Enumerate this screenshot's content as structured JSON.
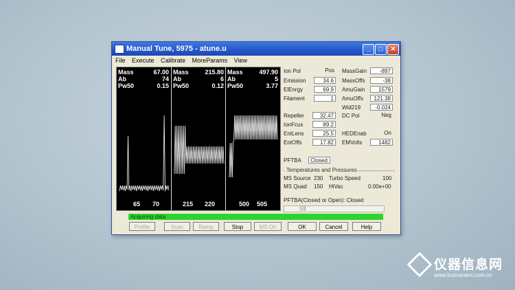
{
  "window": {
    "title": "Manual Tune, 5975 - atune.u",
    "controls": {
      "minimize": "_",
      "maximize": "□",
      "close": "✕"
    }
  },
  "menu": [
    "File",
    "Execute",
    "Calibrate",
    "MoreParams",
    "View"
  ],
  "spectra": {
    "panels": [
      {
        "mass_label": "Mass",
        "mass": "67.00",
        "ab_label": "Ab",
        "ab": "74",
        "pw_label": "Pw50",
        "pw": "0.15",
        "ticks": [
          "65",
          "70"
        ]
      },
      {
        "mass_label": "Mass",
        "mass": "215.80",
        "ab_label": "Ab",
        "ab": "6",
        "pw_label": "Pw50",
        "pw": "0.12",
        "ticks": [
          "215",
          "220"
        ]
      },
      {
        "mass_label": "Mass",
        "mass": "497.90",
        "ab_label": "Ab",
        "ab": "5",
        "pw_label": "Pw50",
        "pw": "3.77",
        "ticks": [
          "500",
          "505"
        ]
      }
    ]
  },
  "params": {
    "ion_pol_label": "Ion Pol",
    "ion_pol": "Pos",
    "emission_label": "Emission",
    "emission": "34.6",
    "elenrgy_label": "ElEnrgy",
    "elenrgy": "69.9",
    "filament_label": "Filament",
    "filament": "1",
    "repeller_label": "Repeller",
    "repeller": "32.47",
    "ionfcus_label": "IonFcus",
    "ionfcus": "89.2",
    "entlens_label": "EntLens",
    "entlens": "25.5",
    "entoffs_label": "EntOffs",
    "entoffs": "17.82",
    "massgain_label": "MassGain",
    "massgain": "-897",
    "massoffs_label": "MassOffs",
    "massoffs": "-38",
    "amugain_label": "AmuGain",
    "amugain": "1579",
    "amuoffs_label": "AmuOffs",
    "amuoffs": "121.38",
    "wid219_label": "Wid219",
    "wid219": "-0.024",
    "dcpol_label": "DC Pol",
    "dcpol": "Neg",
    "hedenab_label": "HEDEnab",
    "hedenab": "On",
    "emvolts_label": "EMVolts",
    "emvolts": "1482",
    "pftba_label": "PFTBA",
    "pftba": "Closed"
  },
  "temps": {
    "group_title": "Temperatures and Pressures",
    "ms_source_label": "MS Source",
    "ms_source": "230",
    "turbo_label": "Turbo Speed",
    "turbo": "100",
    "ms_quad_label": "MS Quad",
    "ms_quad": "150",
    "hivac_label": "HiVac",
    "hivac": "0.00e+00",
    "pftba_status": "PFTBA(Closed or   Open): Closed"
  },
  "status": {
    "text": "Acquiring data"
  },
  "buttons": {
    "profile": "Profile",
    "scan": "Scan",
    "ramp": "Ramp",
    "stop": "Stop",
    "ms_on": "MS On",
    "ok": "OK",
    "cancel": "Cancel",
    "help": "Help"
  },
  "watermark": {
    "text": "仪器信息网",
    "url": "www.instrument.com.cn"
  }
}
